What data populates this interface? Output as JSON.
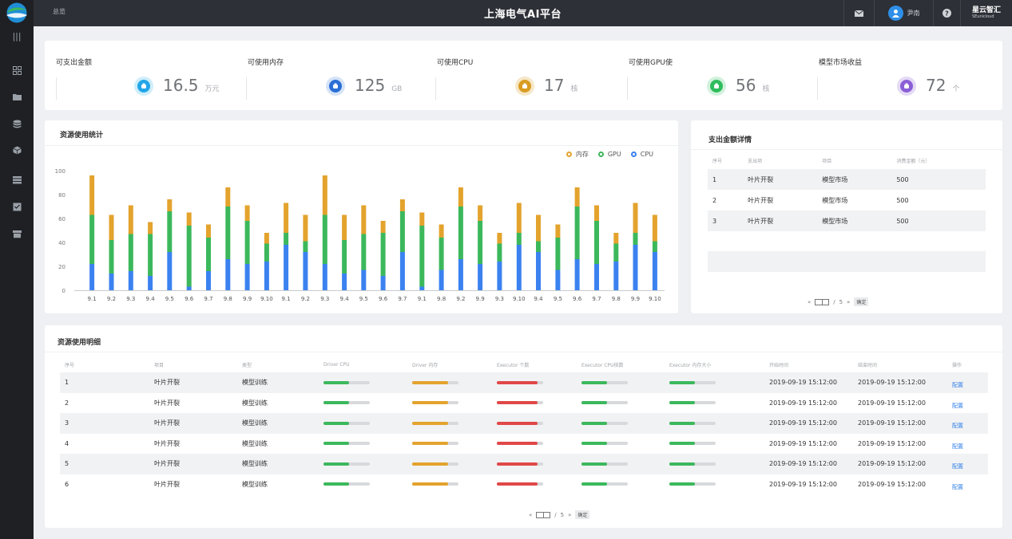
{
  "topbar": {
    "breadcrumb": "总览",
    "title": "上海电气AI平台",
    "user_name": "尹南",
    "brand_name": "星云智汇",
    "brand_sub": "SEunicloud",
    "icons": [
      "mail-icon",
      "user-icon",
      "help-icon"
    ]
  },
  "sidebar": {
    "menu_glyph": "|||",
    "items": [
      "dashboard-icon",
      "folder-icon",
      "database-icon",
      "cube-icon",
      "list-icon",
      "inbox-icon",
      "archive-icon"
    ]
  },
  "stats": [
    {
      "label": "可支出金额",
      "value": "16.5",
      "unit": "万元",
      "color": "#22a6e8",
      "ring": "#cfeefa",
      "icon": "money-bag-icon"
    },
    {
      "label": "可使用内存",
      "value": "125",
      "unit": "GB",
      "color": "#2b6fd6",
      "ring": "#d5e3f7",
      "icon": "memory-icon"
    },
    {
      "label": "可使用CPU",
      "value": "17",
      "unit": "核",
      "color": "#d99c22",
      "ring": "#f6e7c8",
      "icon": "cpu-icon"
    },
    {
      "label": "可使用GPU使",
      "value": "56",
      "unit": "核",
      "color": "#2ebd5c",
      "ring": "#d2f1dc",
      "icon": "gpu-icon"
    },
    {
      "label": "模型市场收益",
      "value": "72",
      "unit": "个",
      "color": "#8a5fd6",
      "ring": "#e4daf5",
      "icon": "income-bag-icon"
    }
  ],
  "chart": {
    "title": "资源使用统计"
  },
  "chart_data": {
    "type": "bar",
    "stacked": true,
    "categories": [
      "9.1",
      "9.2",
      "9.3",
      "9.4",
      "9.5",
      "9.6",
      "9.7",
      "9.8",
      "9.9",
      "9.10",
      "9.1",
      "9.2",
      "9.3",
      "9.4",
      "9.5",
      "9.6",
      "9.7",
      "9.1",
      "9.8",
      "9.2",
      "9.9",
      "9.3",
      "9.10",
      "9.4",
      "9.5",
      "9.6",
      "9.7",
      "9.8",
      "9.9",
      "9.10"
    ],
    "series": [
      {
        "name": "CPU",
        "color": "#3b82f0",
        "values": [
          22,
          14,
          16,
          12,
          32,
          3,
          16,
          26,
          22,
          24,
          38,
          32,
          22,
          14,
          17,
          12,
          32,
          3,
          17,
          26,
          22,
          24,
          38,
          32,
          17,
          26,
          22,
          24,
          38,
          32
        ]
      },
      {
        "name": "GPU",
        "color": "#3cb85c",
        "values": [
          41,
          28,
          31,
          35,
          34,
          51,
          28,
          44,
          36,
          15,
          10,
          9,
          41,
          28,
          30,
          36,
          34,
          51,
          27,
          44,
          36,
          15,
          10,
          9,
          27,
          44,
          36,
          15,
          10,
          9
        ]
      },
      {
        "name": "内存",
        "color": "#e3a32d",
        "values": [
          33,
          21,
          24,
          10,
          10,
          11,
          11,
          16,
          13,
          9,
          25,
          22,
          33,
          21,
          24,
          10,
          10,
          11,
          11,
          16,
          13,
          9,
          25,
          22,
          11,
          16,
          13,
          9,
          25,
          22
        ]
      }
    ],
    "legend_order": [
      "内存",
      "GPU",
      "CPU"
    ],
    "yticks": [
      "0",
      "20",
      "40",
      "60",
      "80",
      "100"
    ],
    "ylim": [
      0,
      100
    ],
    "grid": false,
    "legend_position": "top-right"
  },
  "expense": {
    "title": "支出金额详情",
    "headers": [
      "序号",
      "支出项",
      "项目",
      "消费金额（元）"
    ],
    "rows": [
      [
        "1",
        "叶片开裂",
        "模型市场",
        "500"
      ],
      [
        "2",
        "叶片开裂",
        "模型市场",
        "500"
      ],
      [
        "3",
        "叶片开裂",
        "模型市场",
        "500"
      ]
    ],
    "pager": {
      "prev": "«",
      "sep": "/",
      "total": "5",
      "next": "»",
      "go": "确定"
    }
  },
  "detail": {
    "title": "资源使用明细",
    "headers": [
      "序号",
      "项目",
      "类型",
      "Driver CPU",
      "Driver 内存",
      "Executor 个数",
      "Executor CPU核数",
      "Executor 内存大小",
      "开始时间",
      "结束时间",
      "操作"
    ],
    "rows": [
      {
        "no": "1",
        "project": "叶片开裂",
        "type": "模型训练",
        "start": "2019-09-19 15:12:00",
        "end": "2019-09-19 15:12:00",
        "op": "配置"
      },
      {
        "no": "2",
        "project": "叶片开裂",
        "type": "模型训练",
        "start": "2019-09-19 15:12:00",
        "end": "2019-09-19 15:12:00",
        "op": "配置"
      },
      {
        "no": "3",
        "project": "叶片开裂",
        "type": "模型训练",
        "start": "2019-09-19 15:12:00",
        "end": "2019-09-19 15:12:00",
        "op": "配置"
      },
      {
        "no": "4",
        "project": "叶片开裂",
        "type": "模型训练",
        "start": "2019-09-19 15:12:00",
        "end": "2019-09-19 15:12:00",
        "op": "配置"
      },
      {
        "no": "5",
        "project": "叶片开裂",
        "type": "模型训练",
        "start": "2019-09-19 15:12:00",
        "end": "2019-09-19 15:12:00",
        "op": "配置"
      },
      {
        "no": "6",
        "project": "叶片开裂",
        "type": "模型训练",
        "start": "2019-09-19 15:12:00",
        "end": "2019-09-19 15:12:00",
        "op": "配置"
      }
    ],
    "bar_levels": [
      {
        "fraction": 0.55,
        "color": "#3cb85c"
      },
      {
        "fraction": 0.78,
        "color": "#e3a32d"
      },
      {
        "fraction": 0.88,
        "color": "#e04848"
      },
      {
        "fraction": 0.55,
        "color": "#3cb85c"
      },
      {
        "fraction": 0.55,
        "color": "#3cb85c"
      }
    ],
    "pager": {
      "prev": "«",
      "sep": "/",
      "total": "5",
      "next": "»",
      "go": "确定"
    }
  }
}
